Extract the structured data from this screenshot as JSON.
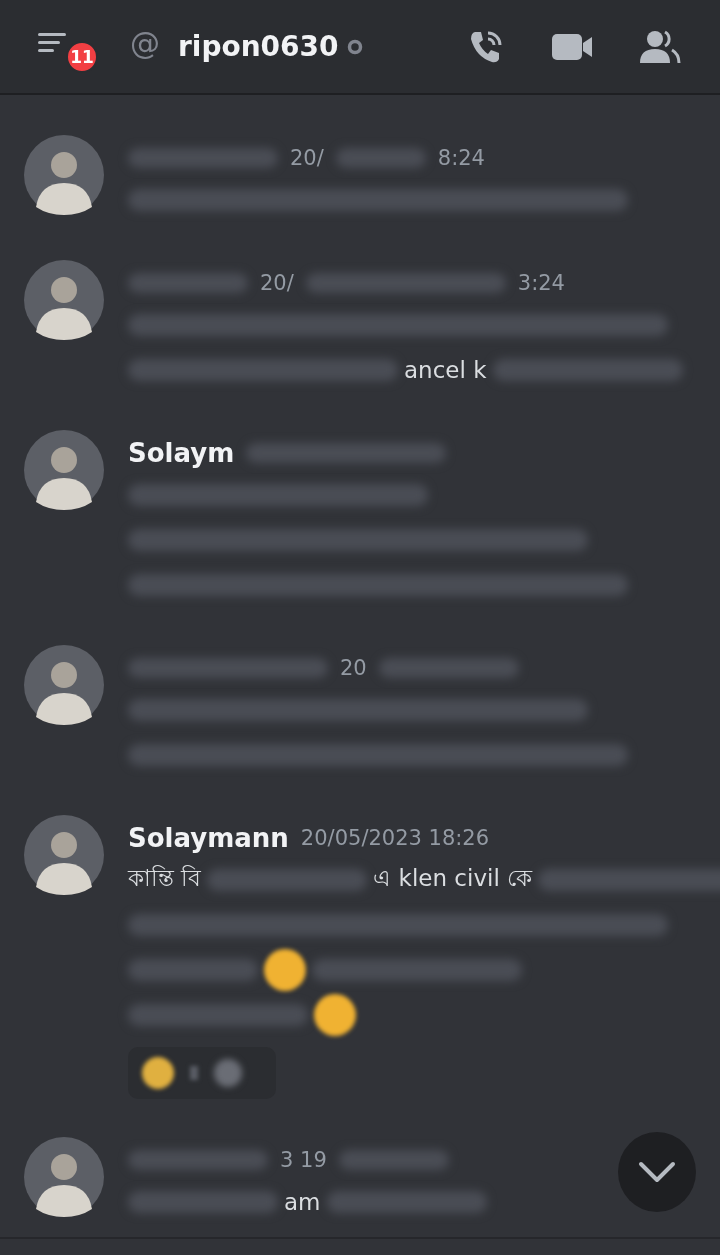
{
  "header": {
    "badge": "11",
    "at_sign": "@",
    "username": "ripon0630"
  },
  "messages": [
    {
      "header": [
        {
          "kind": "blur"
        },
        {
          "kind": "time",
          "text": "20/"
        },
        {
          "kind": "blur"
        },
        {
          "kind": "time",
          "text": "8:24"
        }
      ],
      "lines": [
        [
          {
            "kind": "blur"
          }
        ]
      ],
      "reactions": false
    },
    {
      "header": [
        {
          "kind": "blur"
        },
        {
          "kind": "time",
          "text": "20/"
        },
        {
          "kind": "blur"
        },
        {
          "kind": "time",
          "text": "3:24"
        }
      ],
      "lines": [
        [
          {
            "kind": "blur"
          }
        ],
        [
          {
            "kind": "blur"
          },
          {
            "kind": "text",
            "text": "ancel k"
          },
          {
            "kind": "blur"
          }
        ]
      ],
      "reactions": false
    },
    {
      "header": [
        {
          "kind": "name",
          "text": "Solaym"
        },
        {
          "kind": "blur"
        }
      ],
      "lines": [
        [
          {
            "kind": "blur"
          }
        ],
        [
          {
            "kind": "blur"
          }
        ],
        [
          {
            "kind": "blur"
          }
        ]
      ],
      "reactions": false
    },
    {
      "header": [
        {
          "kind": "blur"
        },
        {
          "kind": "time",
          "text": "20"
        },
        {
          "kind": "blur"
        }
      ],
      "lines": [
        [
          {
            "kind": "blur"
          }
        ],
        [
          {
            "kind": "blur"
          }
        ]
      ],
      "reactions": false
    },
    {
      "header": [
        {
          "kind": "name",
          "text": "Solaymann"
        },
        {
          "kind": "time",
          "text": "20/05/2023 18:26"
        }
      ],
      "lines": [
        [
          {
            "kind": "text",
            "text": "কান্তি বি"
          },
          {
            "kind": "blur"
          },
          {
            "kind": "text",
            "text": "এ klen civil কে"
          },
          {
            "kind": "blur"
          }
        ],
        [
          {
            "kind": "blur"
          }
        ],
        [
          {
            "kind": "blur"
          },
          {
            "kind": "emoji"
          },
          {
            "kind": "blur"
          }
        ],
        [
          {
            "kind": "blur"
          },
          {
            "kind": "emoji"
          }
        ]
      ],
      "reactions": true
    },
    {
      "header": [
        {
          "kind": "blur"
        },
        {
          "kind": "time",
          "text": "3 19"
        },
        {
          "kind": "blur"
        }
      ],
      "lines": [
        [
          {
            "kind": "blur"
          },
          {
            "kind": "text",
            "text": "am"
          },
          {
            "kind": "blur"
          }
        ]
      ],
      "reactions": false
    }
  ]
}
